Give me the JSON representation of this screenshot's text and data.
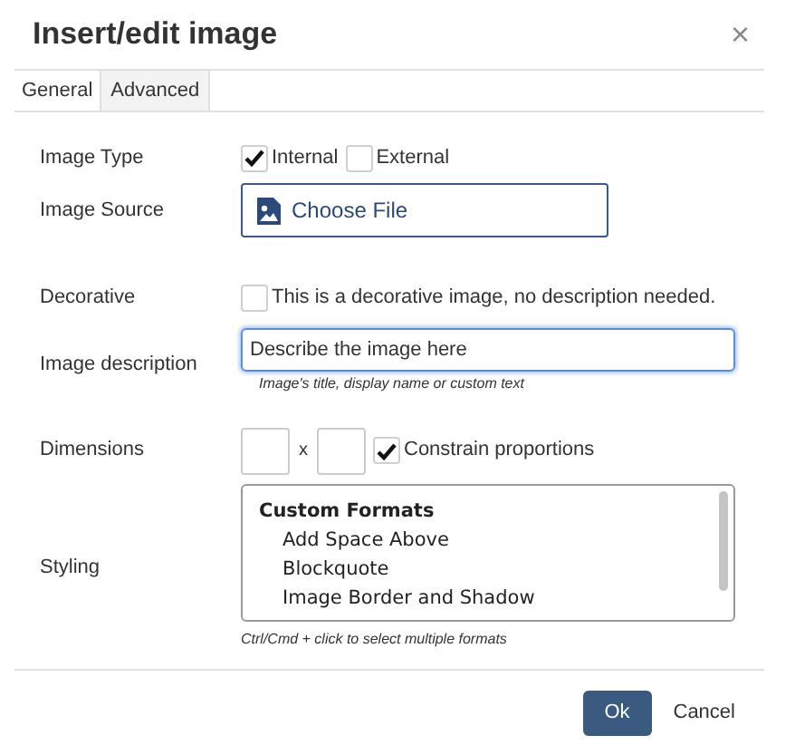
{
  "dialog": {
    "title": "Insert/edit image",
    "close": "×"
  },
  "tabs": [
    {
      "label": "General",
      "selected": true
    },
    {
      "label": "Advanced",
      "selected": false
    }
  ],
  "image_type": {
    "label": "Image Type",
    "options": [
      {
        "label": "Internal",
        "checked": true
      },
      {
        "label": "External",
        "checked": false
      }
    ]
  },
  "image_source": {
    "label": "Image Source",
    "button": "Choose File"
  },
  "decorative": {
    "label": "Decorative",
    "checkbox": "This is a decorative image, no description needed.",
    "checked": false
  },
  "description": {
    "label": "Image description",
    "value": "Describe the image here",
    "focused": true,
    "help": "Image's title, display name or custom text"
  },
  "dimensions": {
    "label": "Dimensions",
    "separator": "x",
    "constrain": "Constrain proportions",
    "checked": true
  },
  "styling": {
    "label": "Styling",
    "items": [
      {
        "kind": "group",
        "label": "Custom Formats"
      },
      {
        "kind": "option",
        "label": "Add Space Above"
      },
      {
        "kind": "option",
        "label": "Blockquote"
      },
      {
        "kind": "option",
        "label": "Image Border and Shadow"
      }
    ],
    "help": "Ctrl/Cmd + click to select multiple formats"
  },
  "buttons": [
    {
      "label": "Ok",
      "kind": "primary"
    },
    {
      "label": "Cancel",
      "kind": "plain"
    }
  ]
}
